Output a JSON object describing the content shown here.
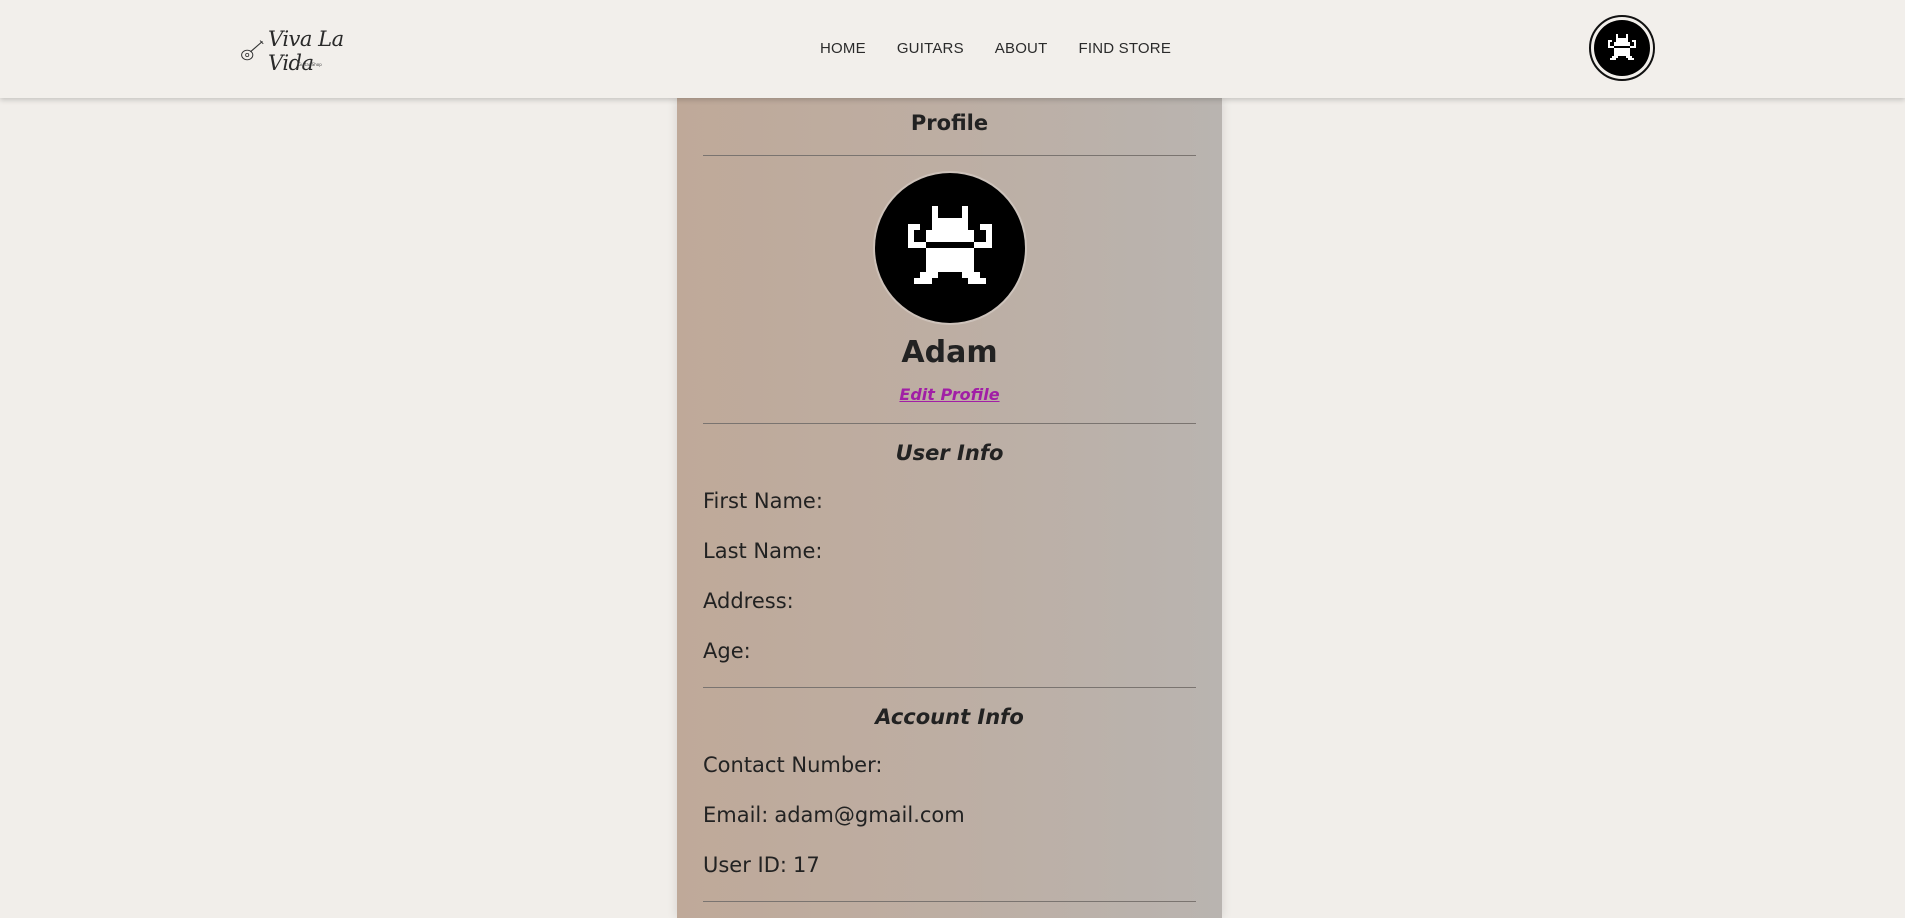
{
  "header": {
    "logo": {
      "text": "Viva La Vida",
      "subtext": "Guitar Shop"
    },
    "nav": [
      {
        "label": "HOME"
      },
      {
        "label": "GUITARS"
      },
      {
        "label": "ABOUT"
      },
      {
        "label": "FIND STORE"
      }
    ],
    "avatar_icon": "pixel-creature-icon"
  },
  "profile": {
    "title": "Profile",
    "avatar_icon": "pixel-creature-icon",
    "name": "Adam",
    "edit_link": "Edit Profile",
    "user_info": {
      "title": "User Info",
      "fields": [
        {
          "label": "First Name:",
          "value": ""
        },
        {
          "label": "Last Name:",
          "value": ""
        },
        {
          "label": "Address:",
          "value": ""
        },
        {
          "label": "Age:",
          "value": ""
        }
      ]
    },
    "account_info": {
      "title": "Account Info",
      "fields": [
        {
          "label": "Contact Number:",
          "value": ""
        },
        {
          "label": "Email:",
          "value": "adam@gmail.com"
        },
        {
          "label": "User ID:",
          "value": "17"
        }
      ]
    }
  },
  "colors": {
    "page_bg": "#f1eeea",
    "card_gradient_left": "#bfa999",
    "card_gradient_right": "#b9b4b0",
    "link": "#a11fa6"
  }
}
